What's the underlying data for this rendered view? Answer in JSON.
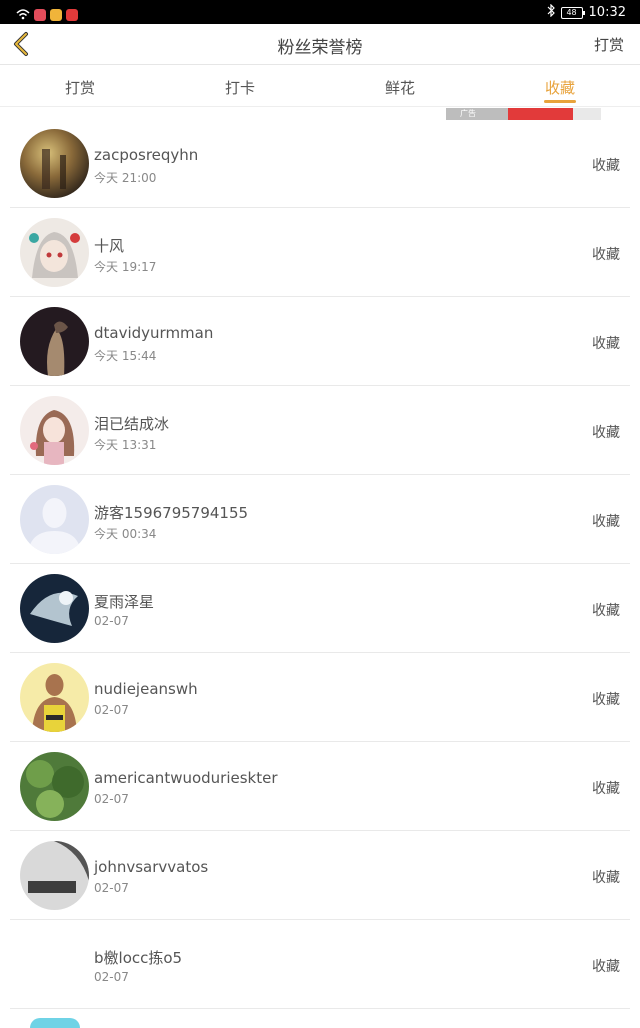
{
  "status_bar": {
    "battery": "48",
    "time": "10:32"
  },
  "header": {
    "title": "粉丝荣誉榜",
    "action_label": "打赏"
  },
  "tabs": [
    {
      "label": "打赏",
      "active": false
    },
    {
      "label": "打卡",
      "active": false
    },
    {
      "label": "鲜花",
      "active": false
    },
    {
      "label": "收藏",
      "active": true
    }
  ],
  "ad": {
    "label": "广告"
  },
  "accent_color": "#e8a33c",
  "fans": [
    {
      "name": "zacposreqyhn",
      "time": "今天 21:00",
      "action": "收藏",
      "avatar": "forest-photo"
    },
    {
      "name": "十风",
      "time": "今天 19:17",
      "action": "收藏",
      "avatar": "anime-girl"
    },
    {
      "name": "dtavidyurmman",
      "time": "今天 15:44",
      "action": "收藏",
      "avatar": "dark-photo"
    },
    {
      "name": "泪已结成冰",
      "time": "今天 13:31",
      "action": "收藏",
      "avatar": "anime-girl-2"
    },
    {
      "name": "游客1596795794155",
      "time": "今天 00:34",
      "action": "收藏",
      "avatar": "default-person"
    },
    {
      "name": "夏雨泽星",
      "time": "02-07",
      "action": "收藏",
      "avatar": "fantasy-art"
    },
    {
      "name": "nudiejeanswh",
      "time": "02-07",
      "action": "收藏",
      "avatar": "gym-man"
    },
    {
      "name": "americantwuodurieskter",
      "time": "02-07",
      "action": "收藏",
      "avatar": "green-leaves"
    },
    {
      "name": "johnvsarvvatos",
      "time": "02-07",
      "action": "收藏",
      "avatar": "bw-photo"
    },
    {
      "name": "b檄locc拣o5",
      "time": "02-07",
      "action": "收藏",
      "avatar": "blank"
    }
  ]
}
